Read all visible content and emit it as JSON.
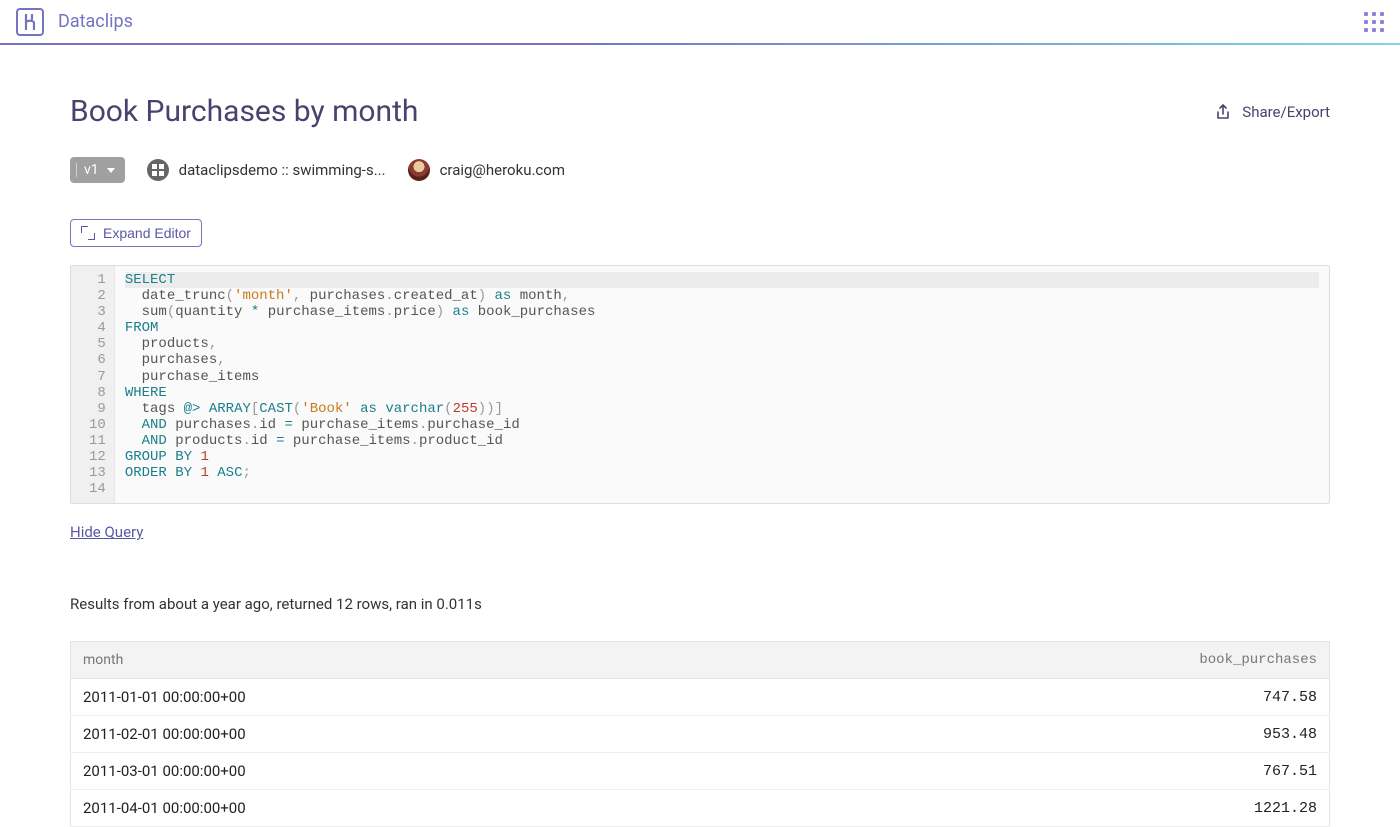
{
  "header": {
    "app_name": "Dataclips"
  },
  "page": {
    "title": "Book Purchases by month",
    "share_label": "Share/Export",
    "version": "v1",
    "database": "dataclipsdemo :: swimming-s...",
    "user_email": "craig@heroku.com",
    "expand_label": "Expand Editor",
    "hide_query_label": "Hide Query",
    "results_meta": "Results from about a year ago, returned 12 rows, ran in 0.011s"
  },
  "sql": {
    "line_count": 14,
    "tokens": [
      [
        {
          "t": "kw",
          "v": "SELECT"
        }
      ],
      [
        {
          "t": "sp",
          "v": "  "
        },
        {
          "t": "fn",
          "v": "date_trunc"
        },
        {
          "t": "punct",
          "v": "("
        },
        {
          "t": "str",
          "v": "'month'"
        },
        {
          "t": "punct",
          "v": ","
        },
        {
          "t": "sp",
          "v": " "
        },
        {
          "t": "ident",
          "v": "purchases"
        },
        {
          "t": "punct",
          "v": "."
        },
        {
          "t": "ident",
          "v": "created_at"
        },
        {
          "t": "punct",
          "v": ")"
        },
        {
          "t": "sp",
          "v": " "
        },
        {
          "t": "as",
          "v": "as"
        },
        {
          "t": "sp",
          "v": " "
        },
        {
          "t": "ident",
          "v": "month"
        },
        {
          "t": "punct",
          "v": ","
        }
      ],
      [
        {
          "t": "sp",
          "v": "  "
        },
        {
          "t": "fn",
          "v": "sum"
        },
        {
          "t": "punct",
          "v": "("
        },
        {
          "t": "ident",
          "v": "quantity"
        },
        {
          "t": "sp",
          "v": " "
        },
        {
          "t": "op",
          "v": "*"
        },
        {
          "t": "sp",
          "v": " "
        },
        {
          "t": "ident",
          "v": "purchase_items"
        },
        {
          "t": "punct",
          "v": "."
        },
        {
          "t": "ident",
          "v": "price"
        },
        {
          "t": "punct",
          "v": ")"
        },
        {
          "t": "sp",
          "v": " "
        },
        {
          "t": "as",
          "v": "as"
        },
        {
          "t": "sp",
          "v": " "
        },
        {
          "t": "ident",
          "v": "book_purchases"
        }
      ],
      [
        {
          "t": "kw",
          "v": "FROM"
        }
      ],
      [
        {
          "t": "sp",
          "v": "  "
        },
        {
          "t": "ident",
          "v": "products"
        },
        {
          "t": "punct",
          "v": ","
        }
      ],
      [
        {
          "t": "sp",
          "v": "  "
        },
        {
          "t": "ident",
          "v": "purchases"
        },
        {
          "t": "punct",
          "v": ","
        }
      ],
      [
        {
          "t": "sp",
          "v": "  "
        },
        {
          "t": "ident",
          "v": "purchase_items"
        }
      ],
      [
        {
          "t": "kw",
          "v": "WHERE"
        }
      ],
      [
        {
          "t": "sp",
          "v": "  "
        },
        {
          "t": "ident",
          "v": "tags"
        },
        {
          "t": "sp",
          "v": " "
        },
        {
          "t": "op",
          "v": "@>"
        },
        {
          "t": "sp",
          "v": " "
        },
        {
          "t": "kw",
          "v": "ARRAY"
        },
        {
          "t": "punct",
          "v": "["
        },
        {
          "t": "kw",
          "v": "CAST"
        },
        {
          "t": "punct",
          "v": "("
        },
        {
          "t": "str",
          "v": "'Book'"
        },
        {
          "t": "sp",
          "v": " "
        },
        {
          "t": "as",
          "v": "as"
        },
        {
          "t": "sp",
          "v": " "
        },
        {
          "t": "kw",
          "v": "varchar"
        },
        {
          "t": "punct",
          "v": "("
        },
        {
          "t": "num",
          "v": "255"
        },
        {
          "t": "punct",
          "v": ")"
        },
        {
          "t": "punct",
          "v": ")"
        },
        {
          "t": "punct",
          "v": "]"
        }
      ],
      [
        {
          "t": "sp",
          "v": "  "
        },
        {
          "t": "kw",
          "v": "AND"
        },
        {
          "t": "sp",
          "v": " "
        },
        {
          "t": "ident",
          "v": "purchases"
        },
        {
          "t": "punct",
          "v": "."
        },
        {
          "t": "ident",
          "v": "id"
        },
        {
          "t": "sp",
          "v": " "
        },
        {
          "t": "op",
          "v": "="
        },
        {
          "t": "sp",
          "v": " "
        },
        {
          "t": "ident",
          "v": "purchase_items"
        },
        {
          "t": "punct",
          "v": "."
        },
        {
          "t": "ident",
          "v": "purchase_id"
        }
      ],
      [
        {
          "t": "sp",
          "v": "  "
        },
        {
          "t": "kw",
          "v": "AND"
        },
        {
          "t": "sp",
          "v": " "
        },
        {
          "t": "ident",
          "v": "products"
        },
        {
          "t": "punct",
          "v": "."
        },
        {
          "t": "ident",
          "v": "id"
        },
        {
          "t": "sp",
          "v": " "
        },
        {
          "t": "op",
          "v": "="
        },
        {
          "t": "sp",
          "v": " "
        },
        {
          "t": "ident",
          "v": "purchase_items"
        },
        {
          "t": "punct",
          "v": "."
        },
        {
          "t": "ident",
          "v": "product_id"
        }
      ],
      [
        {
          "t": "kw",
          "v": "GROUP"
        },
        {
          "t": "sp",
          "v": " "
        },
        {
          "t": "kw",
          "v": "BY"
        },
        {
          "t": "sp",
          "v": " "
        },
        {
          "t": "num",
          "v": "1"
        }
      ],
      [
        {
          "t": "kw",
          "v": "ORDER"
        },
        {
          "t": "sp",
          "v": " "
        },
        {
          "t": "kw",
          "v": "BY"
        },
        {
          "t": "sp",
          "v": " "
        },
        {
          "t": "num",
          "v": "1"
        },
        {
          "t": "sp",
          "v": " "
        },
        {
          "t": "kw",
          "v": "ASC"
        },
        {
          "t": "punct",
          "v": ";"
        }
      ],
      []
    ]
  },
  "results": {
    "columns": [
      "month",
      "book_purchases"
    ],
    "rows": [
      {
        "month": "2011-01-01 00:00:00+00",
        "book_purchases": "747.58"
      },
      {
        "month": "2011-02-01 00:00:00+00",
        "book_purchases": "953.48"
      },
      {
        "month": "2011-03-01 00:00:00+00",
        "book_purchases": "767.51"
      },
      {
        "month": "2011-04-01 00:00:00+00",
        "book_purchases": "1221.28"
      }
    ]
  }
}
